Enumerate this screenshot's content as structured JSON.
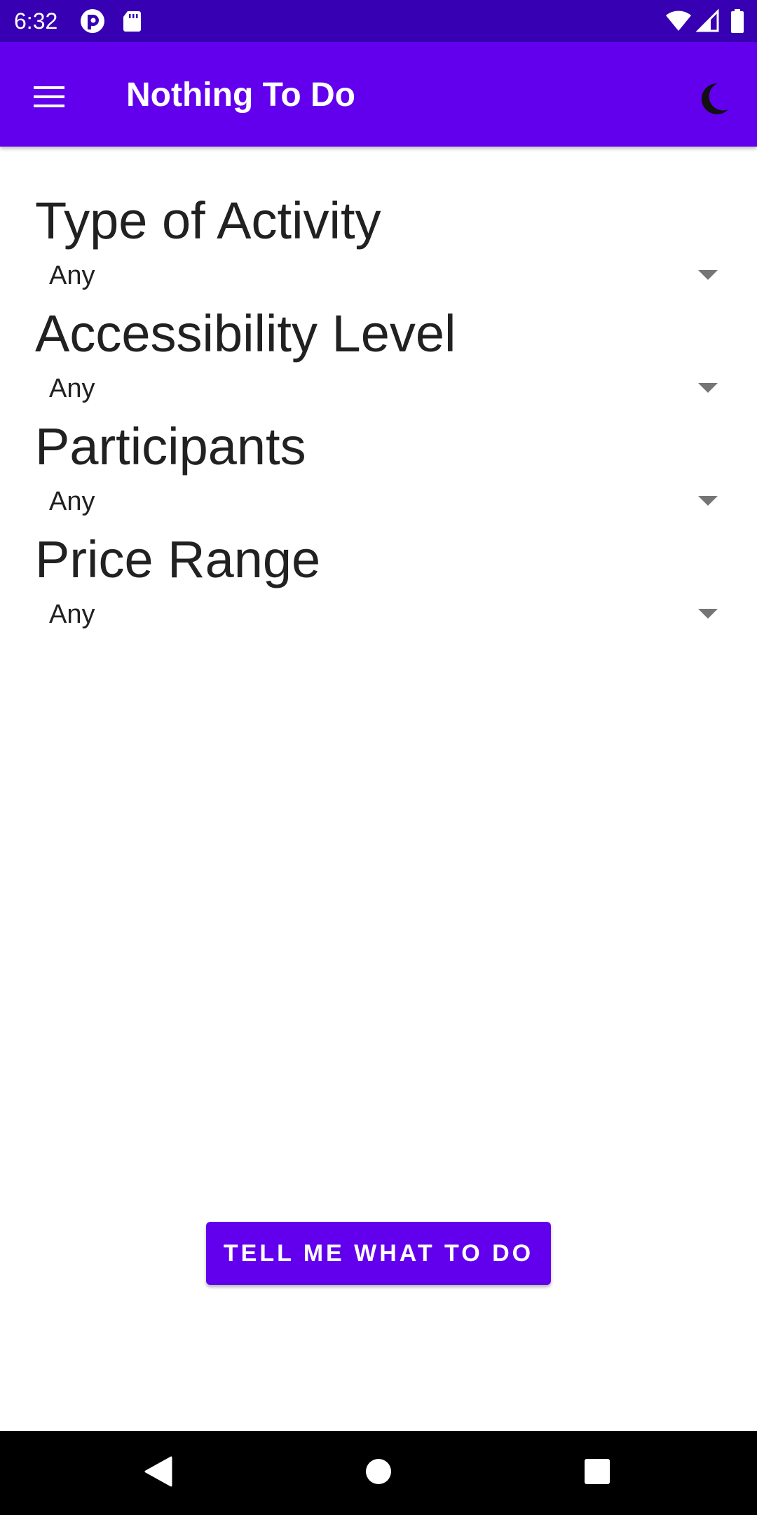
{
  "status_bar": {
    "time": "6:32",
    "icons": [
      "notification-app-icon",
      "sd-card-icon",
      "wifi-icon",
      "signal-icon",
      "battery-icon"
    ]
  },
  "app_bar": {
    "menu_icon": "hamburger-menu-icon",
    "title": "Nothing To Do",
    "theme_icon": "dark-mode-moon-icon"
  },
  "filters": [
    {
      "label": "Type of Activity",
      "value": "Any"
    },
    {
      "label": "Accessibility Level",
      "value": "Any"
    },
    {
      "label": "Participants",
      "value": "Any"
    },
    {
      "label": "Price Range",
      "value": "Any"
    }
  ],
  "action_button": {
    "label": "TELL ME WHAT TO DO"
  },
  "nav_bar": {
    "icons": [
      "back-icon",
      "home-icon",
      "recents-icon"
    ]
  },
  "colors": {
    "status_bar": "#3700b3",
    "app_bar": "#6200ee",
    "accent": "#6200ee",
    "nav_bar": "#000000"
  }
}
